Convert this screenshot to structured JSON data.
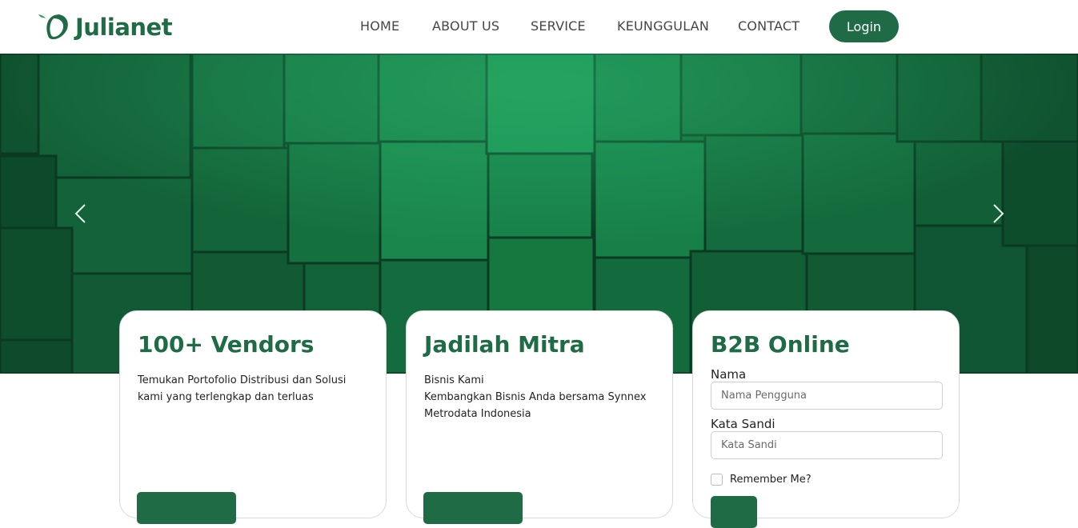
{
  "brand": {
    "name": "Julianet",
    "color": "#1e6b45"
  },
  "nav": {
    "items": [
      {
        "label": "HOME"
      },
      {
        "label": "ABOUT US"
      },
      {
        "label": "SERVICE"
      },
      {
        "label": "KEUNGGULAN"
      },
      {
        "label": "CONTACT"
      }
    ],
    "login_label": "Login"
  },
  "hero": {
    "prev_icon": "chevron-left-icon",
    "next_icon": "chevron-right-icon"
  },
  "cards": {
    "vendors": {
      "title": "100+ Vendors",
      "text": "Temukan Portofolio Distribusi dan Solusi kami yang terlengkap dan terluas"
    },
    "mitra": {
      "title": "Jadilah Mitra",
      "line1": "Bisnis Kami",
      "line2": "Kembangkan Bisnis Anda bersama Synnex Metrodata Indonesia"
    },
    "b2b": {
      "title": "B2B Online",
      "name_label": "Nama",
      "name_placeholder": "Nama Pengguna",
      "password_label": "Kata Sandi",
      "password_placeholder": "Kata Sandi",
      "remember_label": "Remember Me?"
    }
  }
}
